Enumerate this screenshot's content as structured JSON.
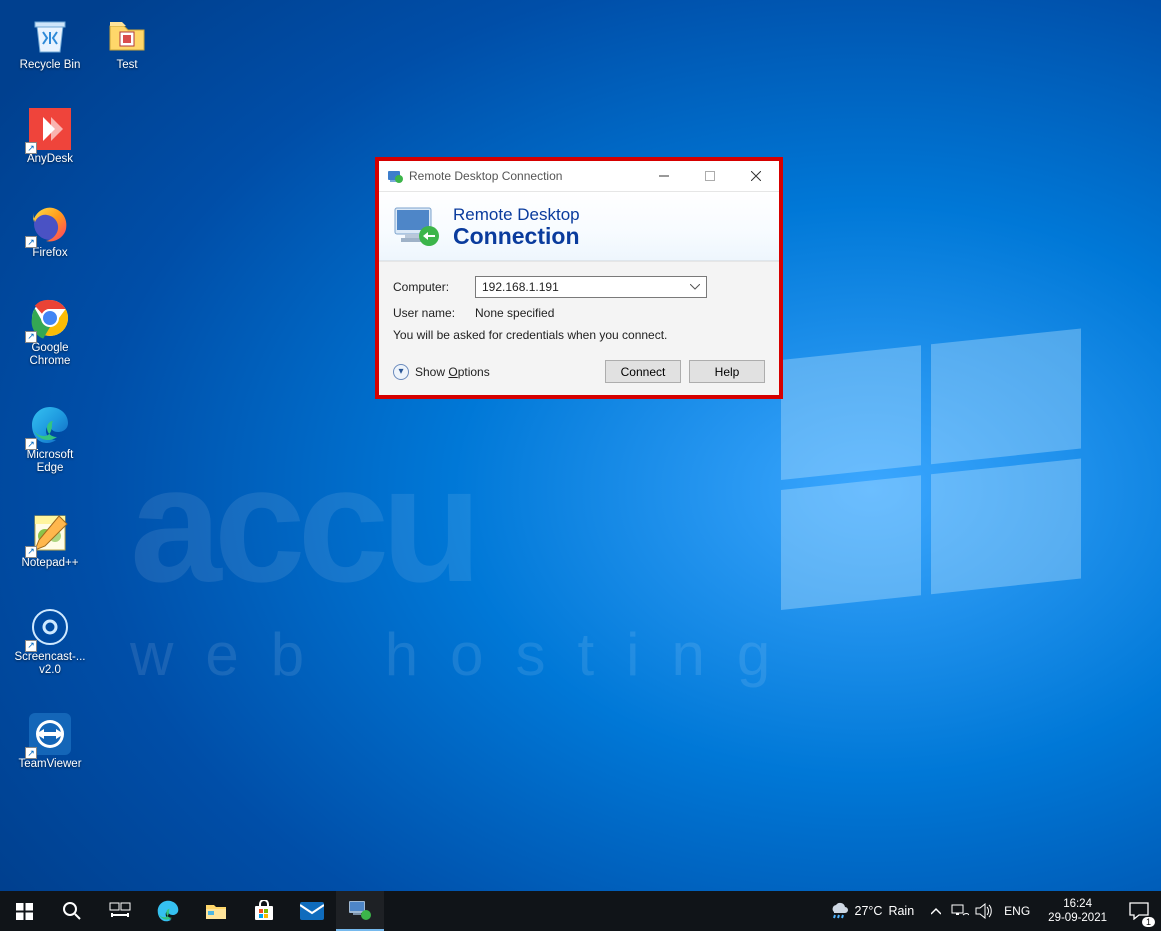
{
  "desktop": {
    "watermark_big": "accu",
    "watermark_small": "web hosting",
    "icons": [
      {
        "id": "recycle-bin",
        "label": "Recycle Bin"
      },
      {
        "id": "anydesk",
        "label": "AnyDesk"
      },
      {
        "id": "firefox",
        "label": "Firefox"
      },
      {
        "id": "chrome",
        "label": "Google Chrome"
      },
      {
        "id": "edge",
        "label": "Microsoft Edge"
      },
      {
        "id": "notepadpp",
        "label": "Notepad++"
      },
      {
        "id": "screencast",
        "label": "Screencast-... v2.0"
      },
      {
        "id": "teamviewer",
        "label": "TeamViewer"
      }
    ],
    "icon_test": {
      "id": "test-folder",
      "label": "Test"
    }
  },
  "rdc": {
    "title": "Remote Desktop Connection",
    "banner_line1": "Remote Desktop",
    "banner_line2": "Connection",
    "computer_label": "Computer:",
    "computer_value": "192.168.1.191",
    "username_label": "User name:",
    "username_value": "None specified",
    "hint": "You will be asked for credentials when you connect.",
    "show_options": "Show Options",
    "connect": "Connect",
    "help": "Help"
  },
  "taskbar": {
    "weather_temp": "27°C",
    "weather_cond": "Rain",
    "lang": "ENG",
    "time": "16:24",
    "date": "29-09-2021",
    "notif_count": "1"
  }
}
